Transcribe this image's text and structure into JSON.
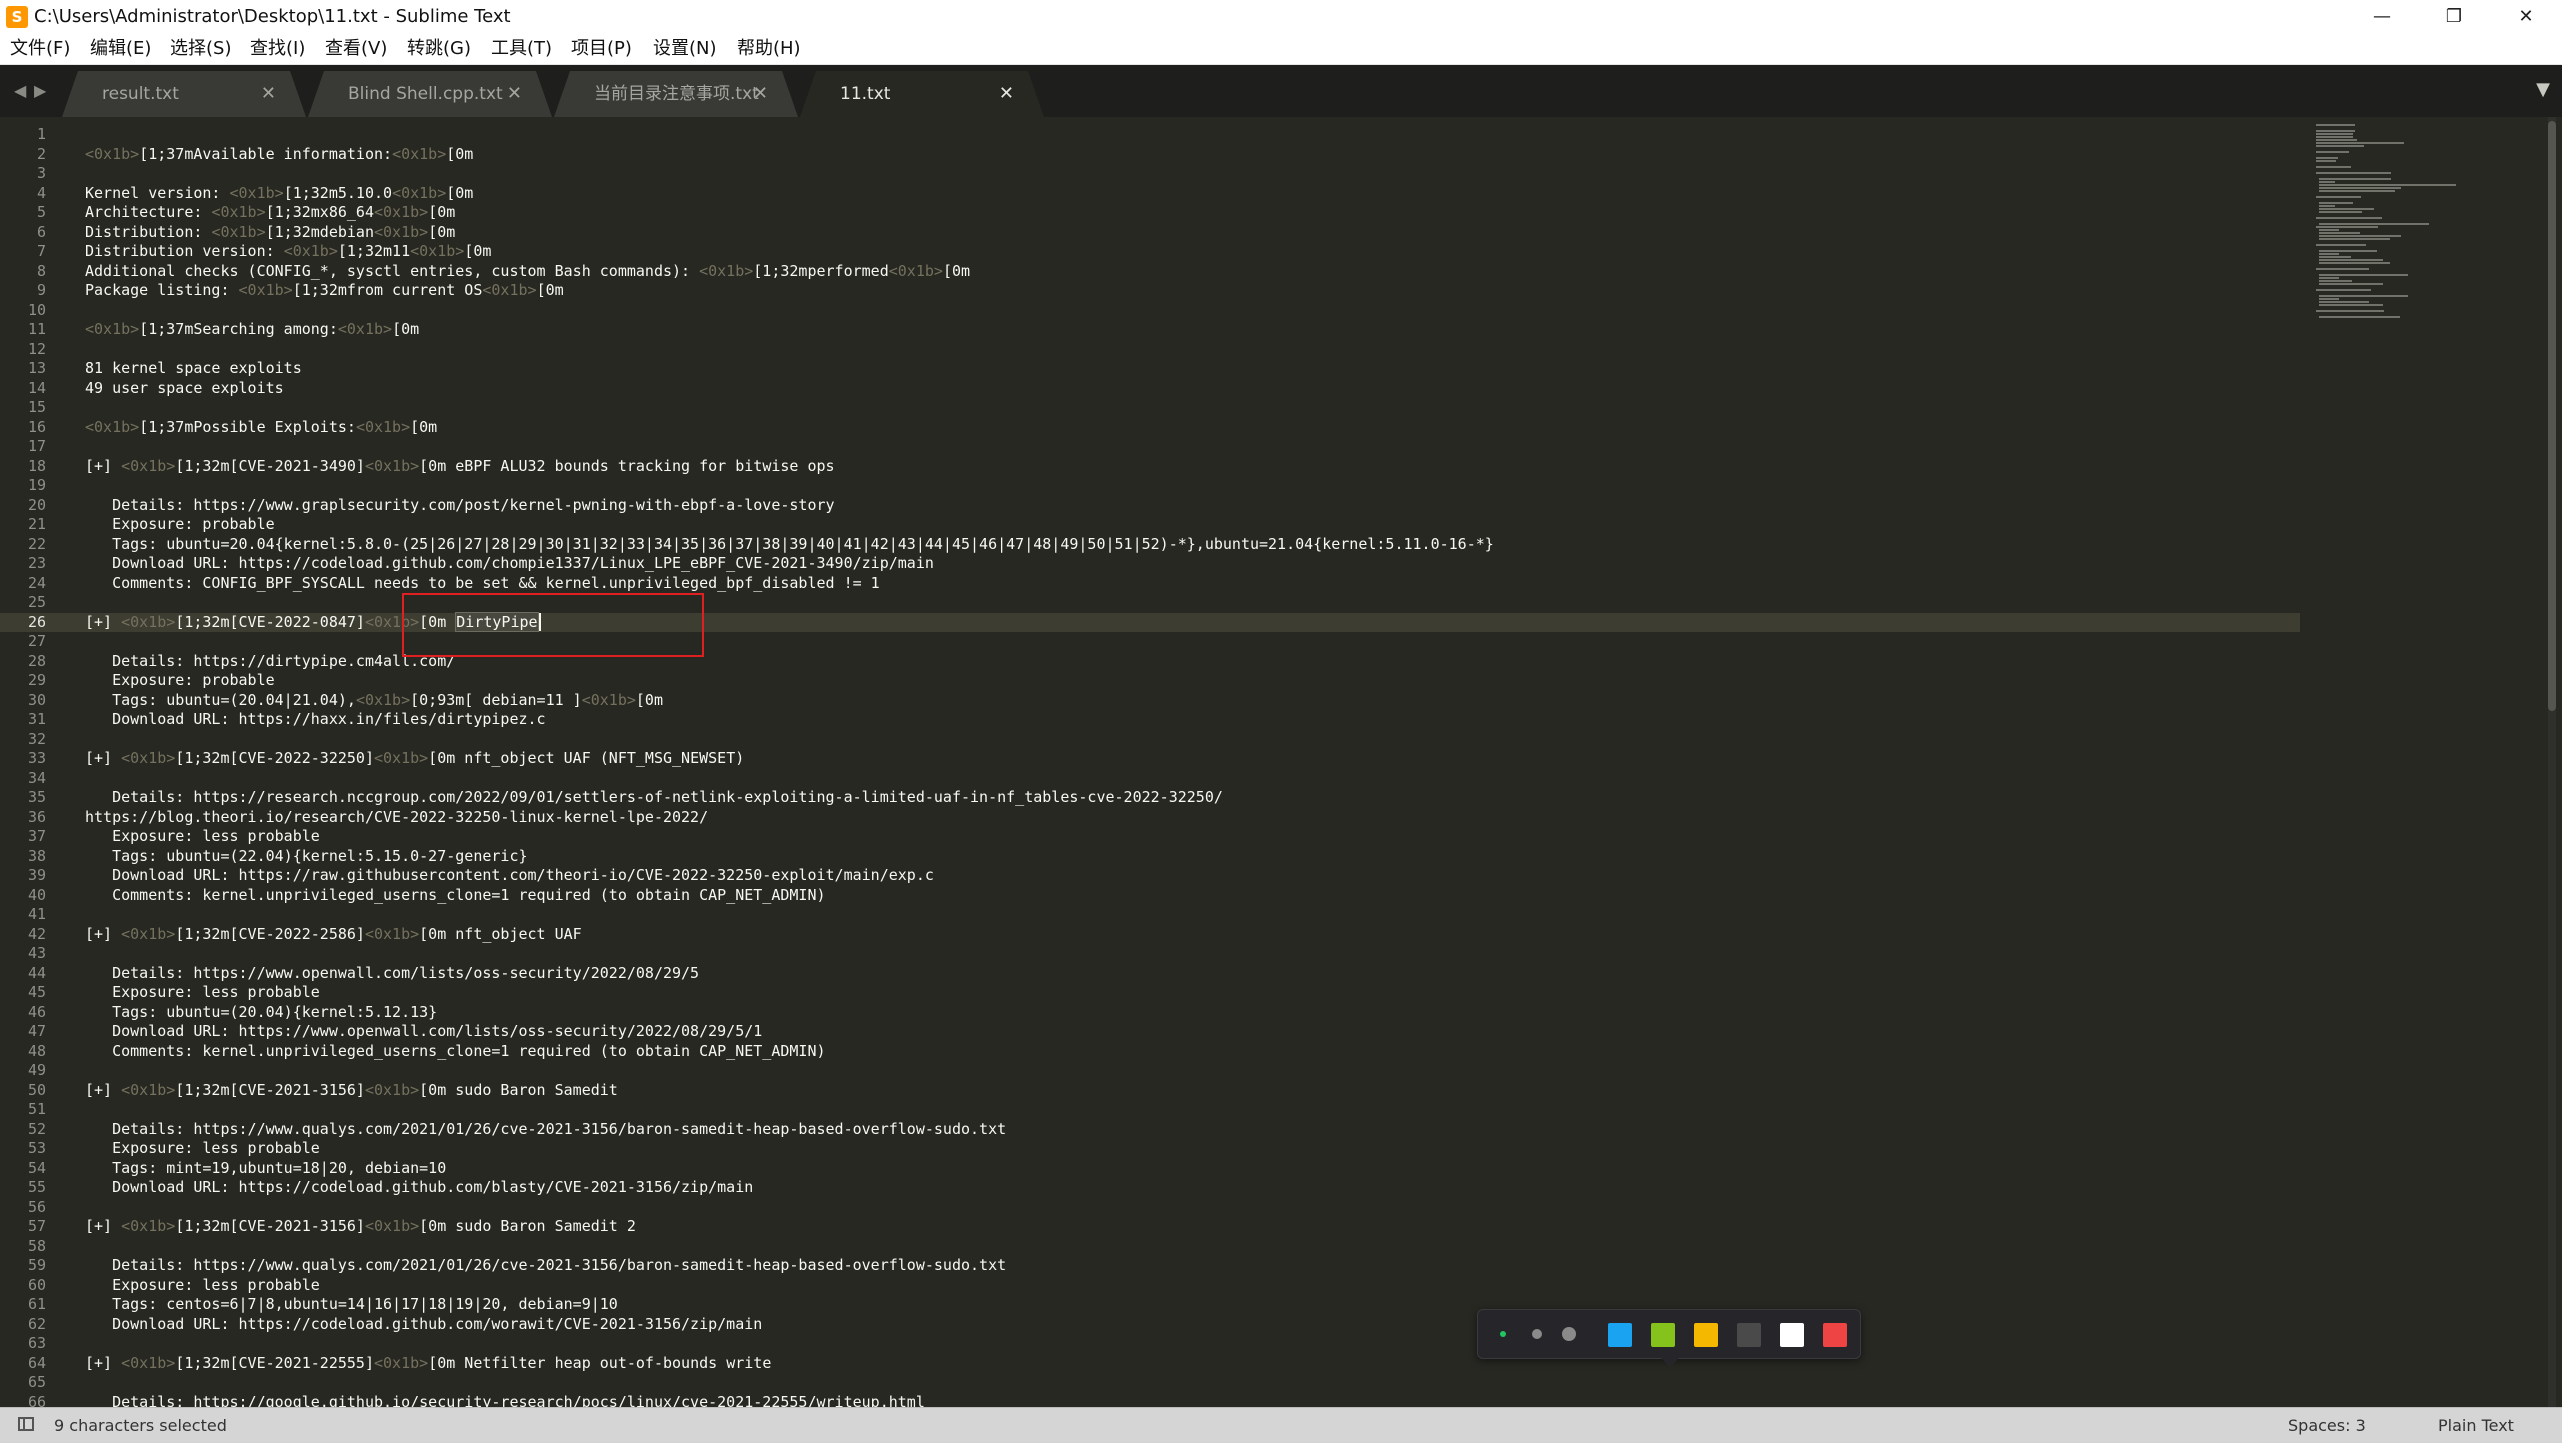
{
  "window": {
    "title": "C:\\Users\\Administrator\\Desktop\\11.txt - Sublime Text",
    "app_icon": "S",
    "minimize_glyph": "—",
    "restore_glyph": "❐",
    "close_glyph": "✕"
  },
  "menu": [
    "文件(F)",
    "编辑(E)",
    "选择(S)",
    "查找(I)",
    "查看(V)",
    "转跳(G)",
    "工具(T)",
    "项目(P)",
    "设置(N)",
    "帮助(H)"
  ],
  "tabs": [
    {
      "label": "result.txt",
      "active": false
    },
    {
      "label": "Blind Shell.cpp.txt",
      "active": false
    },
    {
      "label": "当前目录注意事项.txt",
      "active": false
    },
    {
      "label": "11.txt",
      "active": true
    }
  ],
  "tab_close_glyph": "✕",
  "tab_nav": {
    "left": "◀",
    "right": "▶",
    "dropdown": "▼"
  },
  "editor": {
    "current_line": 26,
    "lines": [
      "",
      "<0x1b>[1;37mAvailable information:<0x1b>[0m",
      "",
      "Kernel version: <0x1b>[1;32m5.10.0<0x1b>[0m",
      "Architecture: <0x1b>[1;32mx86_64<0x1b>[0m",
      "Distribution: <0x1b>[1;32mdebian<0x1b>[0m",
      "Distribution version: <0x1b>[1;32m11<0x1b>[0m",
      "Additional checks (CONFIG_*, sysctl entries, custom Bash commands): <0x1b>[1;32mperformed<0x1b>[0m",
      "Package listing: <0x1b>[1;32mfrom current OS<0x1b>[0m",
      "",
      "<0x1b>[1;37mSearching among:<0x1b>[0m",
      "",
      "81 kernel space exploits",
      "49 user space exploits",
      "",
      "<0x1b>[1;37mPossible Exploits:<0x1b>[0m",
      "",
      "[+] <0x1b>[1;32m[CVE-2021-3490]<0x1b>[0m eBPF ALU32 bounds tracking for bitwise ops",
      "",
      "   Details: https://www.graplsecurity.com/post/kernel-pwning-with-ebpf-a-love-story",
      "   Exposure: probable",
      "   Tags: ubuntu=20.04{kernel:5.8.0-(25|26|27|28|29|30|31|32|33|34|35|36|37|38|39|40|41|42|43|44|45|46|47|48|49|50|51|52)-*},ubuntu=21.04{kernel:5.11.0-16-*}",
      "   Download URL: https://codeload.github.com/chompie1337/Linux_LPE_eBPF_CVE-2021-3490/zip/main",
      "   Comments: CONFIG_BPF_SYSCALL needs to be set && kernel.unprivileged_bpf_disabled != 1",
      "",
      "[+] <0x1b>[1;32m[CVE-2022-0847]<0x1b>[0m DirtyPipe",
      "",
      "   Details: https://dirtypipe.cm4all.com/",
      "   Exposure: probable",
      "   Tags: ubuntu=(20.04|21.04),<0x1b>[0;93m[ debian=11 ]<0x1b>[0m",
      "   Download URL: https://haxx.in/files/dirtypipez.c",
      "",
      "[+] <0x1b>[1;32m[CVE-2022-32250]<0x1b>[0m nft_object UAF (NFT_MSG_NEWSET)",
      "",
      "   Details: https://research.nccgroup.com/2022/09/01/settlers-of-netlink-exploiting-a-limited-uaf-in-nf_tables-cve-2022-32250/",
      "https://blog.theori.io/research/CVE-2022-32250-linux-kernel-lpe-2022/",
      "   Exposure: less probable",
      "   Tags: ubuntu=(22.04){kernel:5.15.0-27-generic}",
      "   Download URL: https://raw.githubusercontent.com/theori-io/CVE-2022-32250-exploit/main/exp.c",
      "   Comments: kernel.unprivileged_userns_clone=1 required (to obtain CAP_NET_ADMIN)",
      "",
      "[+] <0x1b>[1;32m[CVE-2022-2586]<0x1b>[0m nft_object UAF",
      "",
      "   Details: https://www.openwall.com/lists/oss-security/2022/08/29/5",
      "   Exposure: less probable",
      "   Tags: ubuntu=(20.04){kernel:5.12.13}",
      "   Download URL: https://www.openwall.com/lists/oss-security/2022/08/29/5/1",
      "   Comments: kernel.unprivileged_userns_clone=1 required (to obtain CAP_NET_ADMIN)",
      "",
      "[+] <0x1b>[1;32m[CVE-2021-3156]<0x1b>[0m sudo Baron Samedit",
      "",
      "   Details: https://www.qualys.com/2021/01/26/cve-2021-3156/baron-samedit-heap-based-overflow-sudo.txt",
      "   Exposure: less probable",
      "   Tags: mint=19,ubuntu=18|20, debian=10",
      "   Download URL: https://codeload.github.com/blasty/CVE-2021-3156/zip/main",
      "",
      "[+] <0x1b>[1;32m[CVE-2021-3156]<0x1b>[0m sudo Baron Samedit 2",
      "",
      "   Details: https://www.qualys.com/2021/01/26/cve-2021-3156/baron-samedit-heap-based-overflow-sudo.txt",
      "   Exposure: less probable",
      "   Tags: centos=6|7|8,ubuntu=14|16|17|18|19|20, debian=9|10",
      "   Download URL: https://codeload.github.com/worawit/CVE-2021-3156/zip/main",
      "",
      "[+] <0x1b>[1;32m[CVE-2021-22555]<0x1b>[0m Netfilter heap out-of-bounds write",
      "",
      "   Details: https://google.github.io/security-research/pocs/linux/cve-2021-22555/writeup.html"
    ],
    "selection": {
      "line": 26,
      "text": "DirtyPipe"
    }
  },
  "color_toolbar": {
    "dot_colors": [
      "#22c55e",
      "#8a8a8a",
      "#8a8a8a"
    ],
    "swatch_colors": [
      "#1aa3f0",
      "#86c21c",
      "#f5b800",
      "#4a4a4a",
      "#ffffff",
      "#ef4444"
    ]
  },
  "status": {
    "selection": "9 characters selected",
    "indent": "Spaces: 3",
    "syntax": "Plain Text"
  },
  "theme": {
    "editor_bg": "#272822",
    "text": "#f8f8f2",
    "escape_text": "#75715e",
    "line_number": "#90908a",
    "highlight_box": "#e02020"
  }
}
